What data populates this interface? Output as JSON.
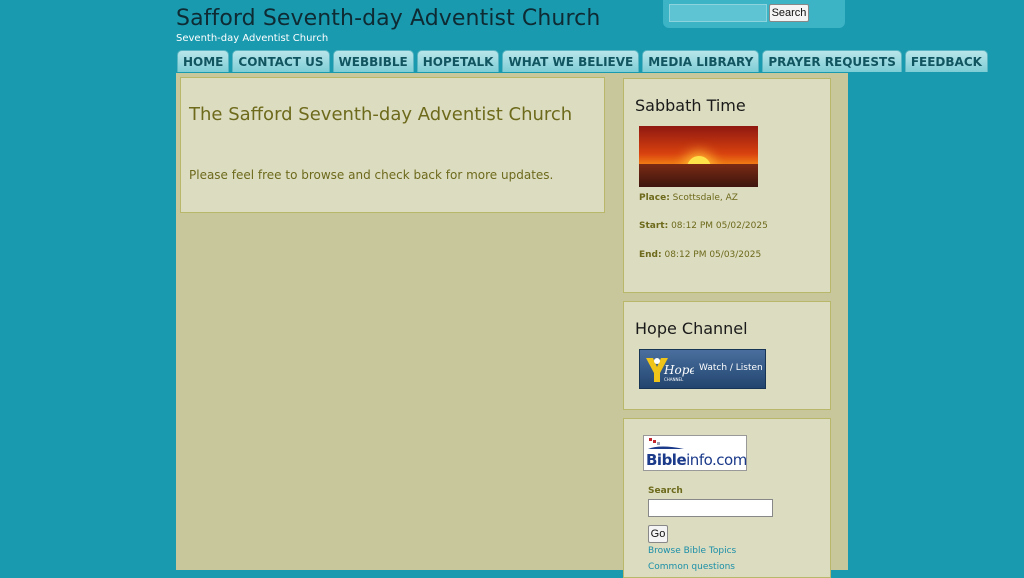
{
  "header": {
    "title": "Safford Seventh-day Adventist Church",
    "subtitle": "Seventh-day Adventist Church",
    "search_button": "Search"
  },
  "nav": {
    "tabs": [
      {
        "label": "HOME"
      },
      {
        "label": "CONTACT US"
      },
      {
        "label": "WEBBIBLE"
      },
      {
        "label": "HOPETALK"
      },
      {
        "label": "WHAT WE BELIEVE"
      },
      {
        "label": "MEDIA LIBRARY"
      },
      {
        "label": "PRAYER REQUESTS"
      },
      {
        "label": "FEEDBACK"
      }
    ]
  },
  "main": {
    "title": "The Safford Seventh-day Adventist Church",
    "text": "Please feel free to browse and check back for more updates."
  },
  "sabbath": {
    "title": "Sabbath Time",
    "place_label": "Place:",
    "place_value": "Scottsdale, AZ",
    "start_label": "Start:",
    "start_value": "08:12 PM 05/02/2025",
    "end_label": "End:",
    "end_value": "08:12 PM 05/03/2025"
  },
  "hope": {
    "title": "Hope Channel",
    "button_label": "Watch / Listen",
    "logo_text": "Hope",
    "logo_subtext": "CHANNEL"
  },
  "bibleinfo": {
    "logo_bold": "Bible",
    "logo_light": "info.com",
    "search_label": "Search",
    "go_button": "Go",
    "links": [
      {
        "label": "Browse Bible Topics"
      },
      {
        "label": "Common questions"
      }
    ]
  },
  "colors": {
    "background": "#1a9aaf",
    "content": "#c8c79b",
    "panel": "#dcdcc0",
    "text_olive": "#6d6a1c",
    "link": "#1b8fa8"
  }
}
